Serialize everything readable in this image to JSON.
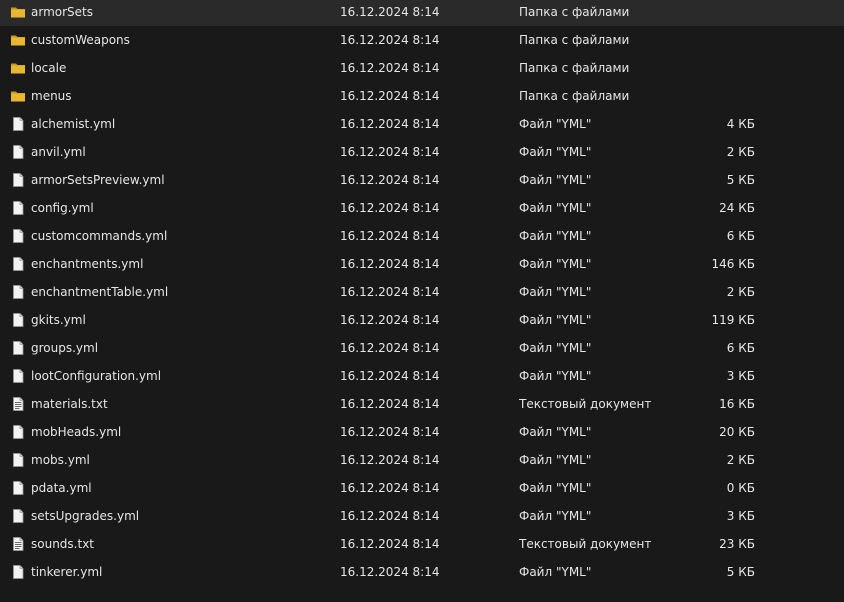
{
  "colors": {
    "background": "#191919",
    "text": "#e6e6e6",
    "folder": "#e8b730",
    "document": "#f2f2f2"
  },
  "files": [
    {
      "name": "armorSets",
      "date": "16.12.2024 8:14",
      "type": "Папка с файлами",
      "size": "",
      "icon": "folder-icon"
    },
    {
      "name": "customWeapons",
      "date": "16.12.2024 8:14",
      "type": "Папка с файлами",
      "size": "",
      "icon": "folder-icon"
    },
    {
      "name": "locale",
      "date": "16.12.2024 8:14",
      "type": "Папка с файлами",
      "size": "",
      "icon": "folder-icon"
    },
    {
      "name": "menus",
      "date": "16.12.2024 8:14",
      "type": "Папка с файлами",
      "size": "",
      "icon": "folder-icon"
    },
    {
      "name": "alchemist.yml",
      "date": "16.12.2024 8:14",
      "type": "Файл \"YML\"",
      "size": "4 КБ",
      "icon": "file-icon"
    },
    {
      "name": "anvil.yml",
      "date": "16.12.2024 8:14",
      "type": "Файл \"YML\"",
      "size": "2 КБ",
      "icon": "file-icon"
    },
    {
      "name": "armorSetsPreview.yml",
      "date": "16.12.2024 8:14",
      "type": "Файл \"YML\"",
      "size": "5 КБ",
      "icon": "file-icon"
    },
    {
      "name": "config.yml",
      "date": "16.12.2024 8:14",
      "type": "Файл \"YML\"",
      "size": "24 КБ",
      "icon": "file-icon"
    },
    {
      "name": "customcommands.yml",
      "date": "16.12.2024 8:14",
      "type": "Файл \"YML\"",
      "size": "6 КБ",
      "icon": "file-icon"
    },
    {
      "name": "enchantments.yml",
      "date": "16.12.2024 8:14",
      "type": "Файл \"YML\"",
      "size": "146 КБ",
      "icon": "file-icon"
    },
    {
      "name": "enchantmentTable.yml",
      "date": "16.12.2024 8:14",
      "type": "Файл \"YML\"",
      "size": "2 КБ",
      "icon": "file-icon"
    },
    {
      "name": "gkits.yml",
      "date": "16.12.2024 8:14",
      "type": "Файл \"YML\"",
      "size": "119 КБ",
      "icon": "file-icon"
    },
    {
      "name": "groups.yml",
      "date": "16.12.2024 8:14",
      "type": "Файл \"YML\"",
      "size": "6 КБ",
      "icon": "file-icon"
    },
    {
      "name": "lootConfiguration.yml",
      "date": "16.12.2024 8:14",
      "type": "Файл \"YML\"",
      "size": "3 КБ",
      "icon": "file-icon"
    },
    {
      "name": "materials.txt",
      "date": "16.12.2024 8:14",
      "type": "Текстовый документ",
      "size": "16 КБ",
      "icon": "text-file-icon"
    },
    {
      "name": "mobHeads.yml",
      "date": "16.12.2024 8:14",
      "type": "Файл \"YML\"",
      "size": "20 КБ",
      "icon": "file-icon"
    },
    {
      "name": "mobs.yml",
      "date": "16.12.2024 8:14",
      "type": "Файл \"YML\"",
      "size": "2 КБ",
      "icon": "file-icon"
    },
    {
      "name": "pdata.yml",
      "date": "16.12.2024 8:14",
      "type": "Файл \"YML\"",
      "size": "0 КБ",
      "icon": "file-icon"
    },
    {
      "name": "setsUpgrades.yml",
      "date": "16.12.2024 8:14",
      "type": "Файл \"YML\"",
      "size": "3 КБ",
      "icon": "file-icon"
    },
    {
      "name": "sounds.txt",
      "date": "16.12.2024 8:14",
      "type": "Текстовый документ",
      "size": "23 КБ",
      "icon": "text-file-icon"
    },
    {
      "name": "tinkerer.yml",
      "date": "16.12.2024 8:14",
      "type": "Файл \"YML\"",
      "size": "5 КБ",
      "icon": "file-icon"
    }
  ]
}
